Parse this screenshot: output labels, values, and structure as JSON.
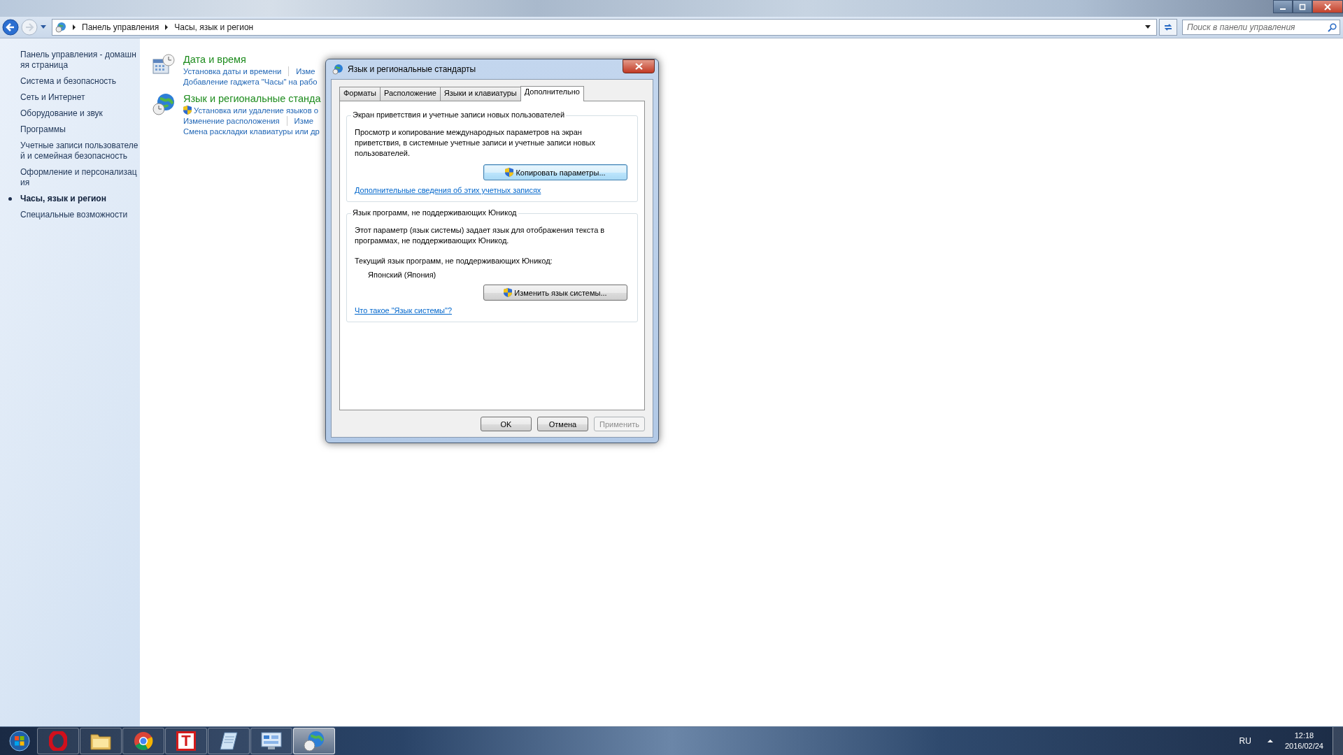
{
  "address_bar": {
    "breadcrumbs": [
      "Панель управления",
      "Часы, язык и регион"
    ]
  },
  "search": {
    "placeholder": "Поиск в панели управления"
  },
  "sidebar": {
    "items": [
      {
        "label": "Панель управления - домашн\nяя страница",
        "selected": false
      },
      {
        "label": "Система и безопасность",
        "selected": false
      },
      {
        "label": "Сеть и Интернет",
        "selected": false
      },
      {
        "label": "Оборудование и звук",
        "selected": false
      },
      {
        "label": "Программы",
        "selected": false
      },
      {
        "label": "Учетные записи пользователе\nй и семейная безопасность",
        "selected": false
      },
      {
        "label": "Оформление и персонализац\nия",
        "selected": false
      },
      {
        "label": "Часы, язык и регион",
        "selected": true
      },
      {
        "label": "Специальные возможности",
        "selected": false
      }
    ]
  },
  "categories": [
    {
      "title": "Дата и время",
      "kind": "clock",
      "rows": [
        [
          {
            "text": "Установка даты и времени",
            "shield": false
          },
          {
            "text": "Изме",
            "shield": false
          }
        ],
        [
          {
            "text": "Добавление гаджета \"Часы\" на рабо",
            "shield": false
          }
        ]
      ]
    },
    {
      "title": "Язык и региональные станда",
      "kind": "globe",
      "rows": [
        [
          {
            "text": "Установка или удаление языков о",
            "shield": true
          }
        ],
        [
          {
            "text": "Изменение расположения",
            "shield": false
          },
          {
            "text": "Изме",
            "shield": false
          }
        ],
        [
          {
            "text": "Смена раскладки клавиатуры или др",
            "shield": false
          }
        ]
      ]
    }
  ],
  "dialog": {
    "title": "Язык и региональные стандарты",
    "tabs": [
      {
        "label": "Форматы",
        "selected": false
      },
      {
        "label": "Расположение",
        "selected": false
      },
      {
        "label": "Языки и клавиатуры",
        "selected": false
      },
      {
        "label": "Дополнительно",
        "selected": true
      }
    ],
    "groups": [
      {
        "title": "Экран приветствия и учетные записи новых пользователей",
        "description": "Просмотр и копирование международных параметров на экран приветствия, в системные учетные записи и учетные записи новых пользователей.",
        "button": {
          "label": "Копировать параметры...",
          "shield": true,
          "focused": true
        },
        "link": "Дополнительные сведения об этих учетных записях"
      },
      {
        "title": "Язык программ, не поддерживающих Юникод",
        "description": "Этот параметр (язык системы) задает язык для отображения текста в программах, не поддерживающих Юникод.",
        "current_label": "Текущий язык программ, не поддерживающих Юникод:",
        "current_value": "Японский (Япония)",
        "button": {
          "label": "Изменить язык системы...",
          "shield": true,
          "focused": false
        },
        "link": "Что такое \"Язык системы\"?"
      }
    ],
    "buttons": [
      {
        "label": "OK",
        "disabled": false
      },
      {
        "label": "Отмена",
        "disabled": false
      },
      {
        "label": "Применить",
        "disabled": true
      }
    ]
  },
  "taskbar": {
    "items": [
      {
        "kind": "opera",
        "active": false
      },
      {
        "kind": "folder",
        "active": false
      },
      {
        "kind": "chrome",
        "active": false
      },
      {
        "kind": "letter",
        "glyph": "T",
        "active": false
      },
      {
        "kind": "notepad",
        "active": false
      },
      {
        "kind": "panel",
        "active": false
      },
      {
        "kind": "globe",
        "active": true
      }
    ],
    "tray": {
      "language": "RU",
      "time": "12:18",
      "date": "2016/02/24"
    }
  }
}
